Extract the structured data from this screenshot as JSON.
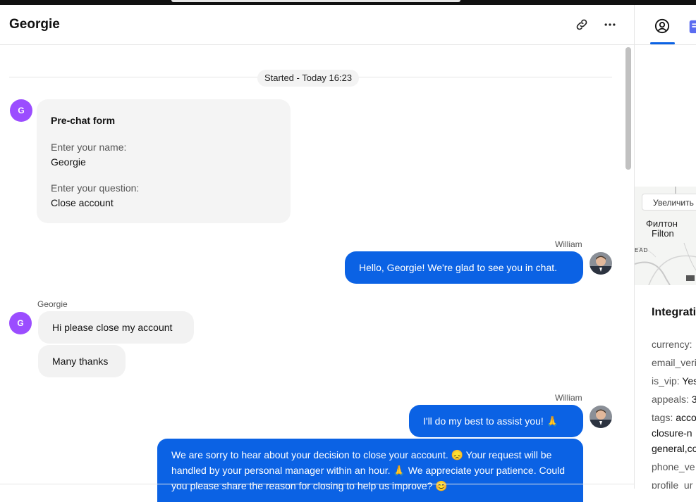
{
  "header": {
    "title": "Georgie",
    "link_icon": "link-icon",
    "more_icon": "more-horizontal-icon"
  },
  "conversation": {
    "started_label": "Started - Today 16:23",
    "prechat": {
      "title": "Pre-chat form",
      "q1": "Enter your name:",
      "a1": "Georgie",
      "q2": "Enter your question:",
      "a2": "Close account"
    },
    "visitor_initial": "G",
    "messages": [
      {
        "sender": "William",
        "text": "Hello, Georgie! We're glad to see you in chat."
      },
      {
        "sender": "Georgie",
        "text": "Hi please close my account"
      },
      {
        "text": "Many thanks"
      },
      {
        "sender": "William",
        "text": "I'll do my best to assist you! 🙏"
      },
      {
        "text": "We are sorry to hear about your decision to close your account. 😞 Your request will be handled by your personal manager within an hour. 🙏 We appreciate your patience. Could you please share the reason for closing to help us improve? 😊"
      }
    ]
  },
  "right_panel": {
    "tabs": [
      {
        "icon": "user-circle-icon",
        "active": true
      },
      {
        "icon": "form-icon",
        "active": false
      }
    ],
    "map": {
      "zoom_button": "Увеличить",
      "city_ru": "Филтон",
      "city_en": "Filton",
      "road_label": "EAD"
    },
    "integration": {
      "title": "Integrations",
      "rows": [
        {
          "key": "currency:",
          "value": ""
        },
        {
          "key": "email_veri",
          "value": ""
        },
        {
          "key": "is_vip:",
          "value": "Yes"
        },
        {
          "key": "appeals:",
          "value": "3"
        },
        {
          "key": "tags:",
          "value": "acco"
        },
        {
          "key": "",
          "value": "closure-n"
        },
        {
          "key": "",
          "value": "general,co"
        },
        {
          "key": "phone_ve",
          "value": ""
        },
        {
          "key": "profile_ur",
          "value": ""
        }
      ]
    }
  },
  "colors": {
    "accent": "#0b62e4",
    "visitor_avatar": "#9b4dff",
    "incoming_bubble": "#f2f2f2"
  }
}
